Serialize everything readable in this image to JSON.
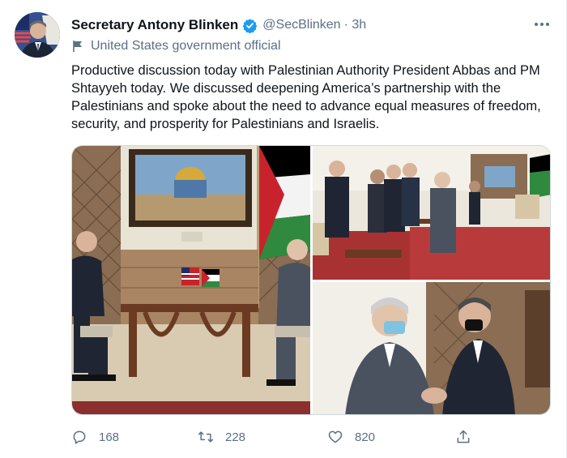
{
  "tweet": {
    "author_name": "Secretary Antony Blinken",
    "handle": "@SecBlinken",
    "time": "· 3h",
    "affiliation": "United States government official",
    "text": "Productive discussion today with Palestinian Authority President Abbas and PM Shtayyeh today. We discussed deepening America’s partnership with the Palestinians and spoke about the need to advance equal measures of freedom, security, and prosperity for Palestinians and Israelis.",
    "reply_count": "168",
    "retweet_count": "228",
    "like_count": "820"
  },
  "icons": {
    "verified": "verified-badge-icon",
    "more": "more-options-icon",
    "affiliation": "flag-icon",
    "reply": "reply-icon",
    "retweet": "retweet-icon",
    "like": "heart-icon",
    "share": "share-icon"
  },
  "colors": {
    "verified_blue": "#1d9bf0",
    "secondary_text": "#5b7083",
    "primary_text": "#0f1419"
  }
}
